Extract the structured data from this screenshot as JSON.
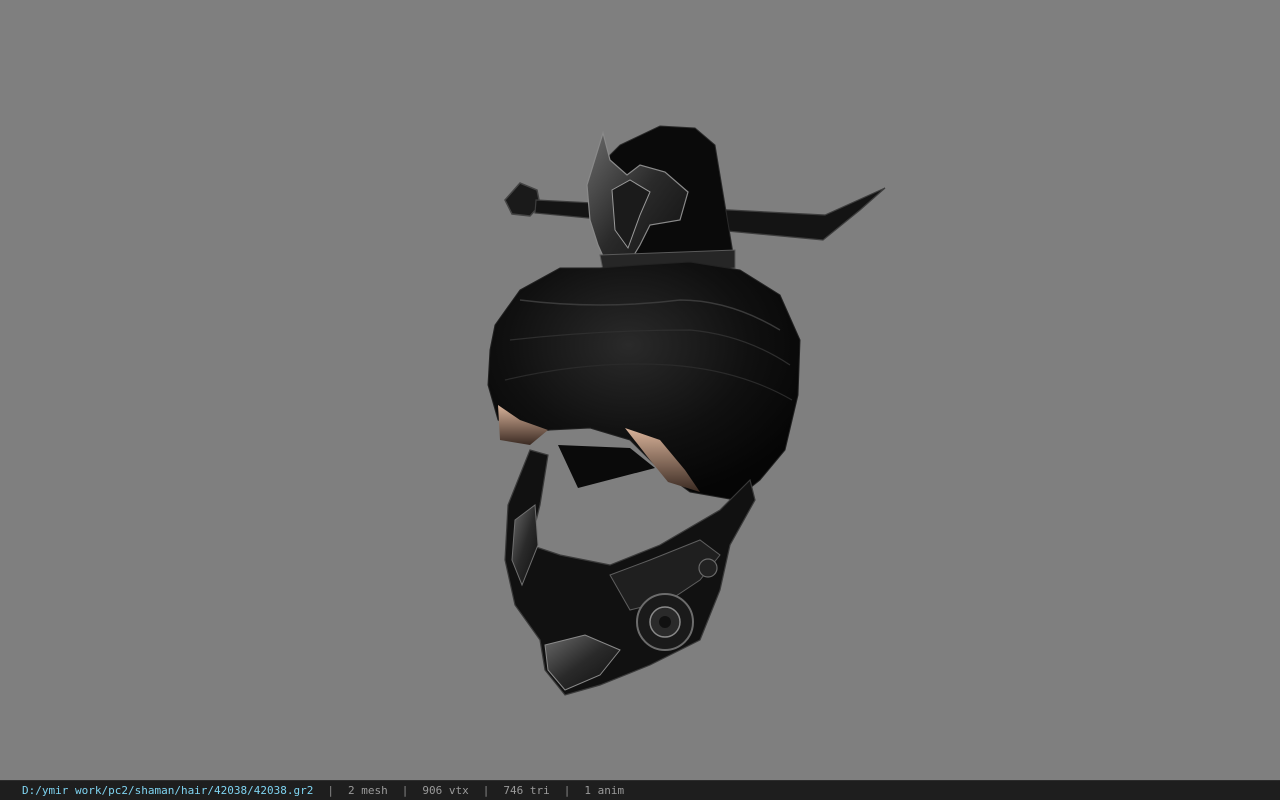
{
  "viewport": {
    "background": "#7f7f7f",
    "model": "hair-with-hairpin-and-mask"
  },
  "status": {
    "path": "D:/ymir work/pc2/shaman/hair/42038/42038.gr2",
    "mesh": "2 mesh",
    "vertices": "906 vtx",
    "triangles": "746 tri",
    "animations": "1 anim",
    "separator": "|"
  },
  "colors": {
    "path": "#7ed3f0",
    "statusbar_bg": "#1e1e1e",
    "stats_text": "#9a9a9a"
  }
}
